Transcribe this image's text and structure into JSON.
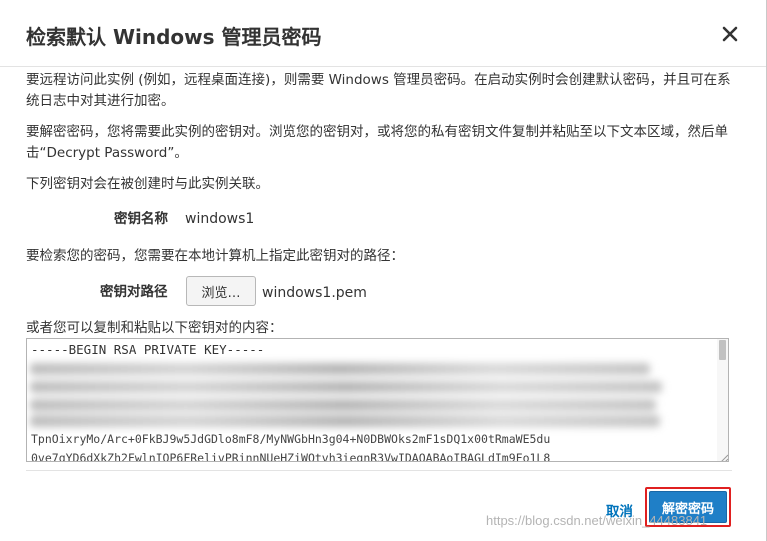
{
  "dialog": {
    "title": "检索默认 Windows 管理员密码",
    "close_icon": "close-icon"
  },
  "content": {
    "intro": "要远程访问此实例 (例如，远程桌面连接)，则需要 Windows 管理员密码。在启动实例时会创建默认密码，并且可在系统日志中对其进行加密。",
    "decrypt_instructions": "要解密密码，您将需要此实例的密钥对。浏览您的密钥对，或将您的私有密钥文件复制并粘贴至以下文本区域，然后单击“Decrypt Password”。",
    "keypair_assoc": "下列密钥对会在被创建时与此实例关联。",
    "key_name_label": "密钥名称",
    "key_name_value": "windows1",
    "path_instructions": "要检索您的密码，您需要在本地计算机上指定此密钥对的路径：",
    "key_path_label": "密钥对路径",
    "browse_label": "浏览…",
    "file_name": "windows1.pem",
    "paste_instructions": "或者您可以复制和粘贴以下密钥对的内容：",
    "key_textarea": "-----BEGIN RSA PRIVATE KEY-----\n\n\n\n\n\n",
    "partial_line_1": "TpnOixryMo/Arc+0FkBJ9w5JdGDlo8mF8/MyNWGbHn3g04+N0DBWOks2mF1sDQ1x00tRmaWE5du",
    "partial_line_2": "0ve7gYD6dXkZh2FwlnIOP6FRelivPRinnNUeHZiWQtvh3iegnR3VwIDAQABAoIBAGLdIm9Fo1L8"
  },
  "footer": {
    "cancel_label": "取消",
    "decrypt_label": "解密密码"
  },
  "watermark": "https://blog.csdn.net/weixin_44483841",
  "colors": {
    "primary_button": "#1f7fc7",
    "link": "#0073bb",
    "highlight_border": "#e02020"
  }
}
